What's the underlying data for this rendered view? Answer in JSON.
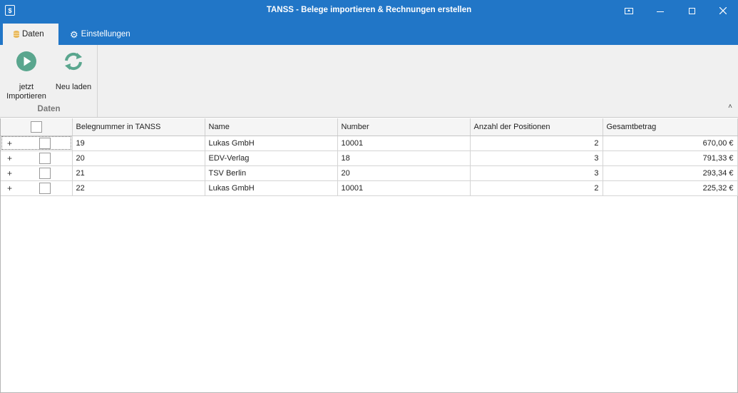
{
  "window": {
    "title": "TANSS - Belege importieren & Rechnungen erstellen",
    "app_icon": "$"
  },
  "tabs": [
    {
      "label": "Daten",
      "icon": "database-icon",
      "active": true
    },
    {
      "label": "Einstellungen",
      "icon": "gears-icon",
      "active": false
    }
  ],
  "ribbon": {
    "import_label": "jetzt Importieren",
    "reload_label": "Neu laden",
    "group_label": "Daten",
    "collapse_glyph": "˄"
  },
  "colors": {
    "titlebar": "#2176c7",
    "icon_green": "#5aa68e"
  },
  "grid": {
    "columns": [
      "Belegnummer in TANSS",
      "Name",
      "Number",
      "Anzahl der Positionen",
      "Gesamtbetrag"
    ],
    "rows": [
      {
        "expander": "+",
        "belegnummer": "19",
        "name": "Lukas GmbH",
        "number": "10001",
        "positionen": "2",
        "betrag": "670,00 €"
      },
      {
        "expander": "+",
        "belegnummer": "20",
        "name": "EDV-Verlag",
        "number": "18",
        "positionen": "3",
        "betrag": "791,33 €"
      },
      {
        "expander": "+",
        "belegnummer": "21",
        "name": "TSV Berlin",
        "number": "20",
        "positionen": "3",
        "betrag": "293,34 €"
      },
      {
        "expander": "+",
        "belegnummer": "22",
        "name": "Lukas GmbH",
        "number": "10001",
        "positionen": "2",
        "betrag": "225,32 €"
      }
    ]
  }
}
